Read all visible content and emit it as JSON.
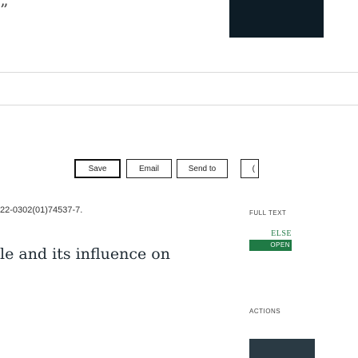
{
  "header": {
    "corner_glyph": "”"
  },
  "toolbar": {
    "buttons": [
      {
        "label": "Save"
      },
      {
        "label": "Email"
      },
      {
        "label": "Send to"
      },
      {
        "label": "("
      }
    ]
  },
  "article": {
    "doi_fragment": "22-0302(01)74537-7.",
    "title_fragment": "le and its influence on"
  },
  "sidebar": {
    "full_text_label": "FULL TEXT",
    "elsevier_badge_top": "ELSE",
    "elsevier_badge_bottom": "OPEN",
    "actions_label": "ACTIONS"
  },
  "colors": {
    "thumb_block": "#0d1c26",
    "elsevier_green": "#1f7a45",
    "actions_button": "#2a3a44"
  }
}
